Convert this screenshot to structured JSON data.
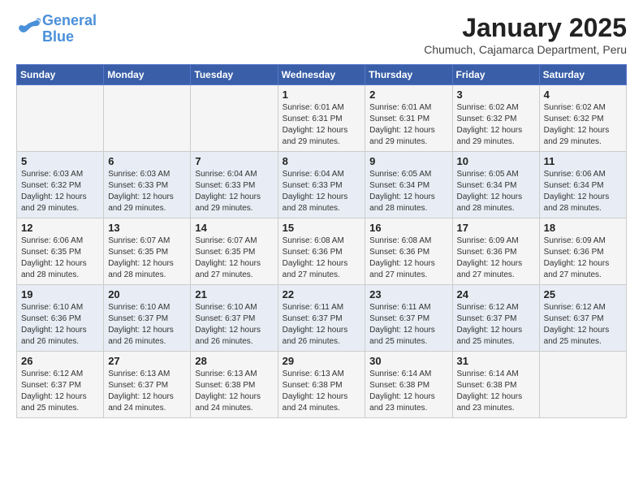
{
  "header": {
    "logo_general": "General",
    "logo_blue": "Blue",
    "month_title": "January 2025",
    "location": "Chumuch, Cajamarca Department, Peru"
  },
  "weekdays": [
    "Sunday",
    "Monday",
    "Tuesday",
    "Wednesday",
    "Thursday",
    "Friday",
    "Saturday"
  ],
  "weeks": [
    [
      {
        "day": "",
        "info": ""
      },
      {
        "day": "",
        "info": ""
      },
      {
        "day": "",
        "info": ""
      },
      {
        "day": "1",
        "info": "Sunrise: 6:01 AM\nSunset: 6:31 PM\nDaylight: 12 hours\nand 29 minutes."
      },
      {
        "day": "2",
        "info": "Sunrise: 6:01 AM\nSunset: 6:31 PM\nDaylight: 12 hours\nand 29 minutes."
      },
      {
        "day": "3",
        "info": "Sunrise: 6:02 AM\nSunset: 6:32 PM\nDaylight: 12 hours\nand 29 minutes."
      },
      {
        "day": "4",
        "info": "Sunrise: 6:02 AM\nSunset: 6:32 PM\nDaylight: 12 hours\nand 29 minutes."
      }
    ],
    [
      {
        "day": "5",
        "info": "Sunrise: 6:03 AM\nSunset: 6:32 PM\nDaylight: 12 hours\nand 29 minutes."
      },
      {
        "day": "6",
        "info": "Sunrise: 6:03 AM\nSunset: 6:33 PM\nDaylight: 12 hours\nand 29 minutes."
      },
      {
        "day": "7",
        "info": "Sunrise: 6:04 AM\nSunset: 6:33 PM\nDaylight: 12 hours\nand 29 minutes."
      },
      {
        "day": "8",
        "info": "Sunrise: 6:04 AM\nSunset: 6:33 PM\nDaylight: 12 hours\nand 28 minutes."
      },
      {
        "day": "9",
        "info": "Sunrise: 6:05 AM\nSunset: 6:34 PM\nDaylight: 12 hours\nand 28 minutes."
      },
      {
        "day": "10",
        "info": "Sunrise: 6:05 AM\nSunset: 6:34 PM\nDaylight: 12 hours\nand 28 minutes."
      },
      {
        "day": "11",
        "info": "Sunrise: 6:06 AM\nSunset: 6:34 PM\nDaylight: 12 hours\nand 28 minutes."
      }
    ],
    [
      {
        "day": "12",
        "info": "Sunrise: 6:06 AM\nSunset: 6:35 PM\nDaylight: 12 hours\nand 28 minutes."
      },
      {
        "day": "13",
        "info": "Sunrise: 6:07 AM\nSunset: 6:35 PM\nDaylight: 12 hours\nand 28 minutes."
      },
      {
        "day": "14",
        "info": "Sunrise: 6:07 AM\nSunset: 6:35 PM\nDaylight: 12 hours\nand 27 minutes."
      },
      {
        "day": "15",
        "info": "Sunrise: 6:08 AM\nSunset: 6:36 PM\nDaylight: 12 hours\nand 27 minutes."
      },
      {
        "day": "16",
        "info": "Sunrise: 6:08 AM\nSunset: 6:36 PM\nDaylight: 12 hours\nand 27 minutes."
      },
      {
        "day": "17",
        "info": "Sunrise: 6:09 AM\nSunset: 6:36 PM\nDaylight: 12 hours\nand 27 minutes."
      },
      {
        "day": "18",
        "info": "Sunrise: 6:09 AM\nSunset: 6:36 PM\nDaylight: 12 hours\nand 27 minutes."
      }
    ],
    [
      {
        "day": "19",
        "info": "Sunrise: 6:10 AM\nSunset: 6:36 PM\nDaylight: 12 hours\nand 26 minutes."
      },
      {
        "day": "20",
        "info": "Sunrise: 6:10 AM\nSunset: 6:37 PM\nDaylight: 12 hours\nand 26 minutes."
      },
      {
        "day": "21",
        "info": "Sunrise: 6:10 AM\nSunset: 6:37 PM\nDaylight: 12 hours\nand 26 minutes."
      },
      {
        "day": "22",
        "info": "Sunrise: 6:11 AM\nSunset: 6:37 PM\nDaylight: 12 hours\nand 26 minutes."
      },
      {
        "day": "23",
        "info": "Sunrise: 6:11 AM\nSunset: 6:37 PM\nDaylight: 12 hours\nand 25 minutes."
      },
      {
        "day": "24",
        "info": "Sunrise: 6:12 AM\nSunset: 6:37 PM\nDaylight: 12 hours\nand 25 minutes."
      },
      {
        "day": "25",
        "info": "Sunrise: 6:12 AM\nSunset: 6:37 PM\nDaylight: 12 hours\nand 25 minutes."
      }
    ],
    [
      {
        "day": "26",
        "info": "Sunrise: 6:12 AM\nSunset: 6:37 PM\nDaylight: 12 hours\nand 25 minutes."
      },
      {
        "day": "27",
        "info": "Sunrise: 6:13 AM\nSunset: 6:37 PM\nDaylight: 12 hours\nand 24 minutes."
      },
      {
        "day": "28",
        "info": "Sunrise: 6:13 AM\nSunset: 6:38 PM\nDaylight: 12 hours\nand 24 minutes."
      },
      {
        "day": "29",
        "info": "Sunrise: 6:13 AM\nSunset: 6:38 PM\nDaylight: 12 hours\nand 24 minutes."
      },
      {
        "day": "30",
        "info": "Sunrise: 6:14 AM\nSunset: 6:38 PM\nDaylight: 12 hours\nand 23 minutes."
      },
      {
        "day": "31",
        "info": "Sunrise: 6:14 AM\nSunset: 6:38 PM\nDaylight: 12 hours\nand 23 minutes."
      },
      {
        "day": "",
        "info": ""
      }
    ]
  ]
}
